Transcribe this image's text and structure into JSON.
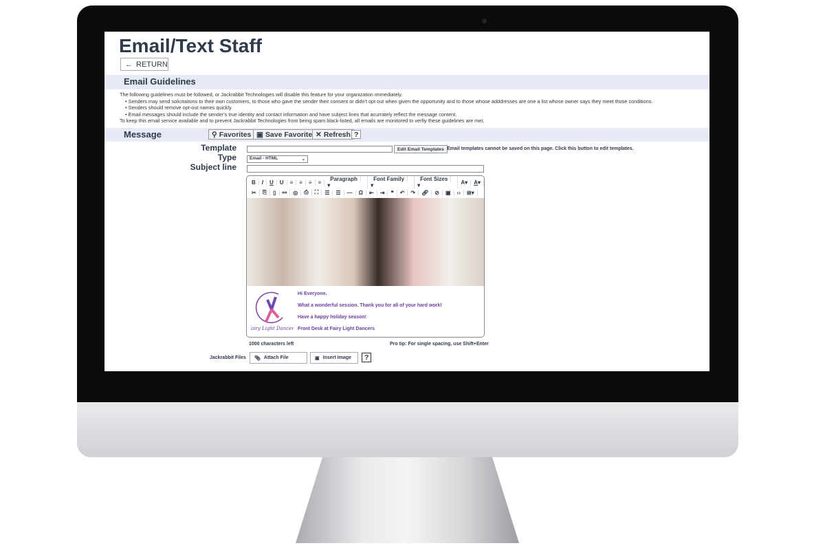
{
  "page": {
    "title": "Email/Text Staff",
    "return_label": "RETURN"
  },
  "guidelines": {
    "heading": "Email Guidelines",
    "intro": "The following guidelines must be followed, or Jackrabbit Technologies will disable this feature for your organization immediately.",
    "bullets": [
      "Senders may send solicitaitons to their own customers, to those who gave the sender their consent or didn't opt out when given the opportunity and to those whose adddresses are one a list whose owner says they meet those conditions.",
      "Senders should remove opt-out names quickly.",
      "Email messages should include the sender's true identity and contact information and have subject lines that acurrately reflect the message content."
    ],
    "footer": "To keep this email service available and to prevent Jackrabbit Technologies from being spam black-listed, all emails are monitored to verfiy these guidelines are met."
  },
  "message": {
    "heading": "Message",
    "favorites": "Favorites",
    "save_favorites": "Save Favorites",
    "refresh": "Refresh",
    "help": "?"
  },
  "form": {
    "template_label": "Template",
    "template_value": "",
    "edit_templates": "Edit Email Templates",
    "template_note": "Email templates cannot be saved on this page. Click this button to edit templates.",
    "type_label": "Type",
    "type_value": "Email - HTML",
    "subject_label": "Subject line",
    "subject_value": ""
  },
  "editor": {
    "paragraph": "Paragraph",
    "font_family": "Font Family",
    "font_sizes": "Font Sizes",
    "logo_text": "Fairy Light Dancers",
    "lines": [
      "Hi Everyone.",
      "What a wonderful session. Thank you for all of your hard work!",
      "Have a happy holiday season!",
      "Front Desk at Fairy Light Dancers"
    ],
    "chars_left": "1000 characters left",
    "pro_tip": "Pro tip: For single spacing, use Shift+Enter"
  },
  "files": {
    "label": "Jackrabbit Files",
    "attach": "Attach File",
    "insert_image": "Insert Image",
    "help": "?"
  }
}
